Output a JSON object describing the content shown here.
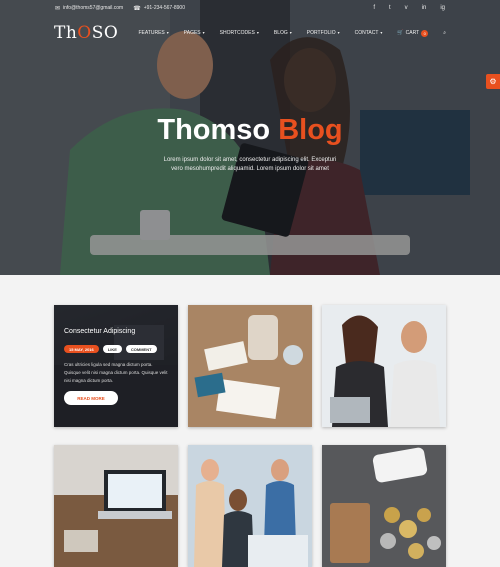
{
  "topbar": {
    "email": "info@thoms57@gmail.com",
    "phone": "+91-234-567-8900",
    "social": [
      "f",
      "t",
      "v",
      "in",
      "ig"
    ]
  },
  "nav": {
    "logo_pre": "Th",
    "logo_o": "O",
    "logo_post": "SO",
    "items": [
      "Features",
      "Pages",
      "Shortcodes",
      "Blog",
      "Portfolio",
      "Contact"
    ],
    "cart_label": "Cart",
    "cart_count": "0"
  },
  "hero": {
    "title_main": "Thomso",
    "title_accent": "Blog",
    "subtitle": "Lorem ipsum dolor sit amet, consectetur adipiscing elit. Excepturi vero mesohumpredit aliquamid. Lorem ipsum dolor sit amet"
  },
  "featured": {
    "title": "Consectetur Adipiscing",
    "tag_date": "15 MAY, 2016",
    "tag_like": "LIKE",
    "tag_comment": "COMMENT",
    "desc": "Cras ultricies ligula sed magna dictum porta. Quisque velit nisi magna dictum porta. Quisque velit nisi magna dictum porta.",
    "button": "READ MORE"
  },
  "colors": {
    "accent": "#e8501f"
  }
}
